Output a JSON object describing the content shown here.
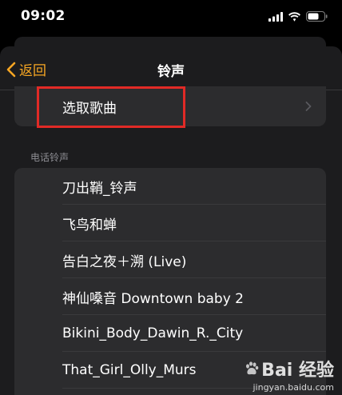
{
  "status_bar": {
    "time": "09:02"
  },
  "nav": {
    "back_label": "返回",
    "title": "铃声"
  },
  "pick_song": {
    "label": "选取歌曲"
  },
  "ringtones": {
    "section_title": "电话铃声",
    "items": [
      "刀出鞘_铃声",
      "飞鸟和蝉",
      "告白之夜＋溯 (Live)",
      "神仙嗓音 Downtown baby 2",
      "Bikini_Body_Dawin_R._City",
      "That_Girl_Olly_Murs"
    ]
  },
  "watermark": {
    "brand": "Bai 经验",
    "url": "jingyan.baidu.com"
  },
  "colors": {
    "accent": "#f6a623",
    "highlight": "#e12a26"
  }
}
